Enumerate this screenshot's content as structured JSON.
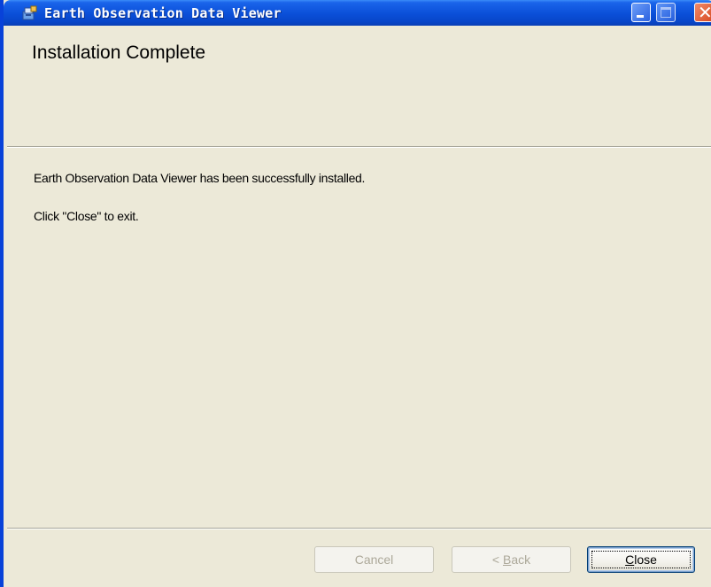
{
  "window": {
    "title": "Earth Observation Data Viewer",
    "app_icon": "installer-icon"
  },
  "titlebar_buttons": {
    "minimize_icon": "minimize-icon",
    "maximize_icon": "maximize-icon",
    "close_icon": "close-icon"
  },
  "banner": {
    "title": "Installation Complete"
  },
  "content": {
    "message": "Earth Observation Data Viewer has been successfully installed.",
    "instruction": "Click \"Close\" to exit."
  },
  "buttons": {
    "cancel": {
      "label": "Cancel",
      "enabled": false
    },
    "back": {
      "mnemonic": "B",
      "rest": "ack",
      "prefix": "< ",
      "enabled": false
    },
    "close": {
      "mnemonic": "C",
      "rest": "lose",
      "enabled": true
    }
  },
  "colors": {
    "titlebar": "#0a4fd8",
    "dialog_bg": "#ece9d8",
    "disabled_text": "#aca899"
  }
}
